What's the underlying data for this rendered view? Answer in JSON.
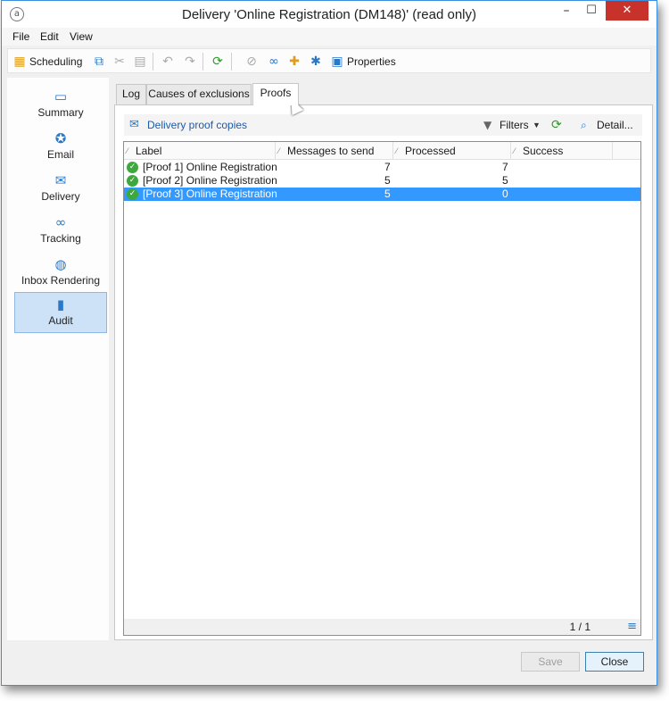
{
  "window": {
    "title": "Delivery 'Online Registration (DM148)' (read only)",
    "app_icon": "a",
    "controls": {
      "minimize": "–",
      "maximize": "☐",
      "close": "✕"
    }
  },
  "menu": {
    "file": "File",
    "edit": "Edit",
    "view": "View"
  },
  "toolbar": {
    "scheduling": "Scheduling",
    "properties": "Properties"
  },
  "sidebar": {
    "items": [
      {
        "label": "Summary",
        "icon": "summary-icon"
      },
      {
        "label": "Email",
        "icon": "email-icon"
      },
      {
        "label": "Delivery",
        "icon": "delivery-icon"
      },
      {
        "label": "Tracking",
        "icon": "tracking-icon"
      },
      {
        "label": "Inbox Rendering",
        "icon": "globe-icon"
      },
      {
        "label": "Audit",
        "icon": "audit-icon"
      }
    ],
    "active": "Audit"
  },
  "tabs": [
    {
      "label": "Log"
    },
    {
      "label": "Causes of exclusions"
    },
    {
      "label": "Proofs"
    }
  ],
  "proofs": {
    "link": "Delivery proof copies",
    "filters": "Filters",
    "detail": "Detail...",
    "columns": [
      "Label",
      "Messages to send",
      "Processed",
      "Success"
    ],
    "rows": [
      {
        "label": "[Proof 1] Online Registration",
        "messages_to_send": "7",
        "processed": "7",
        "success": ""
      },
      {
        "label": "[Proof 2] Online Registration",
        "messages_to_send": "5",
        "processed": "5",
        "success": ""
      },
      {
        "label": "[Proof 3] Online Registration",
        "messages_to_send": "5",
        "processed": "0",
        "success": ""
      }
    ],
    "pager": "1 / 1"
  },
  "buttons": {
    "save": "Save",
    "close": "Close"
  },
  "colors": {
    "selection": "#3399ff",
    "accent": "#2a78c8",
    "close_button": "#c7332b"
  }
}
